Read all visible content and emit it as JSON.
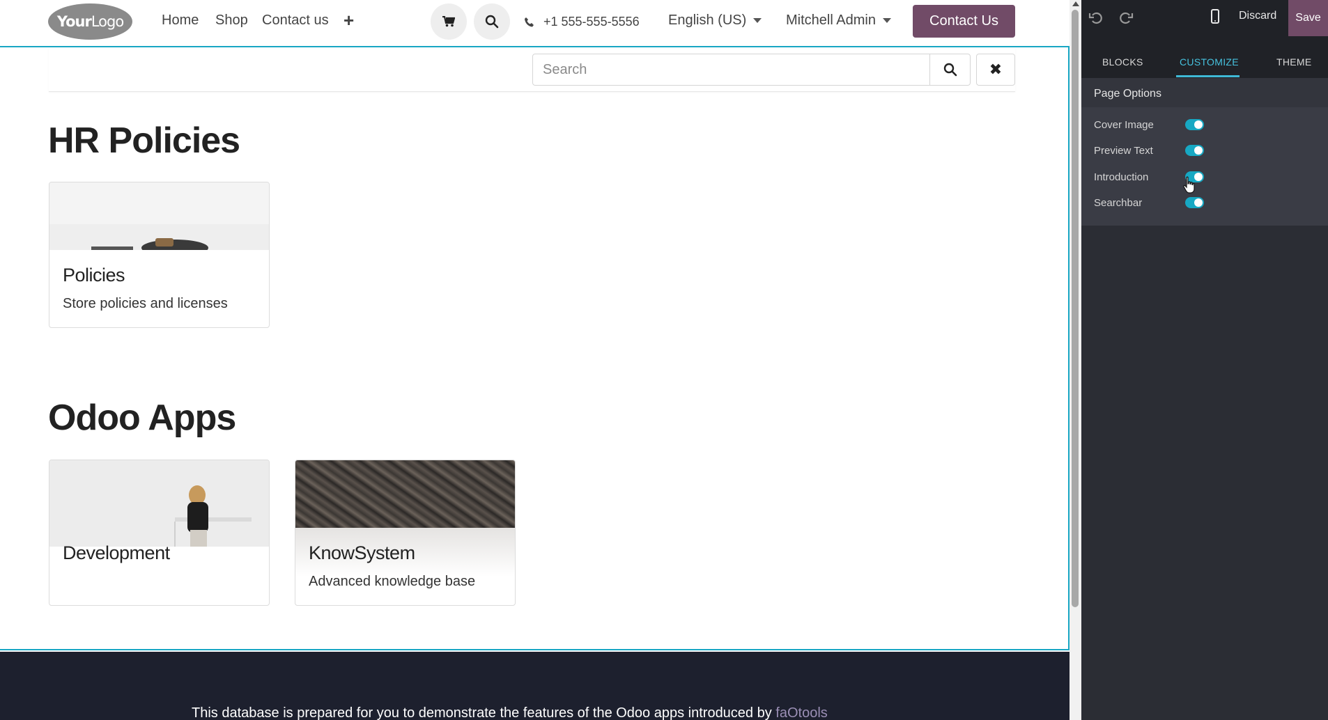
{
  "navbar": {
    "logo_text_bold": "Your",
    "logo_text": "Logo",
    "links": [
      "Home",
      "Shop",
      "Contact us"
    ],
    "phone": "+1 555-555-5556",
    "language": "English (US)",
    "user": "Mitchell Admin",
    "contact_button": "Contact Us"
  },
  "search": {
    "placeholder": "Search"
  },
  "sections": [
    {
      "title": "HR Policies",
      "cards": [
        {
          "title": "Policies",
          "description": "Store policies and licenses"
        }
      ]
    },
    {
      "title": "Odoo Apps",
      "cards": [
        {
          "title": "Development",
          "description": ""
        },
        {
          "title": "KnowSystem",
          "description": "Advanced knowledge base"
        }
      ]
    }
  ],
  "footer": {
    "text": "This database is prepared for you to demonstrate the features of the Odoo apps introduced by ",
    "link": "faOtools"
  },
  "editor": {
    "discard_label": "Discard",
    "save_label": "Save",
    "tabs": [
      "BLOCKS",
      "CUSTOMIZE",
      "THEME"
    ],
    "active_tab": "CUSTOMIZE",
    "options_title": "Page Options",
    "options": [
      {
        "label": "Cover Image",
        "enabled": true
      },
      {
        "label": "Preview Text",
        "enabled": true
      },
      {
        "label": "Introduction",
        "enabled": true
      },
      {
        "label": "Searchbar",
        "enabled": true
      }
    ]
  },
  "colors": {
    "brand": "#714b67",
    "accent": "#17a8c3",
    "footer_bg": "#1d202e",
    "panel_bg": "#2b2d34"
  }
}
